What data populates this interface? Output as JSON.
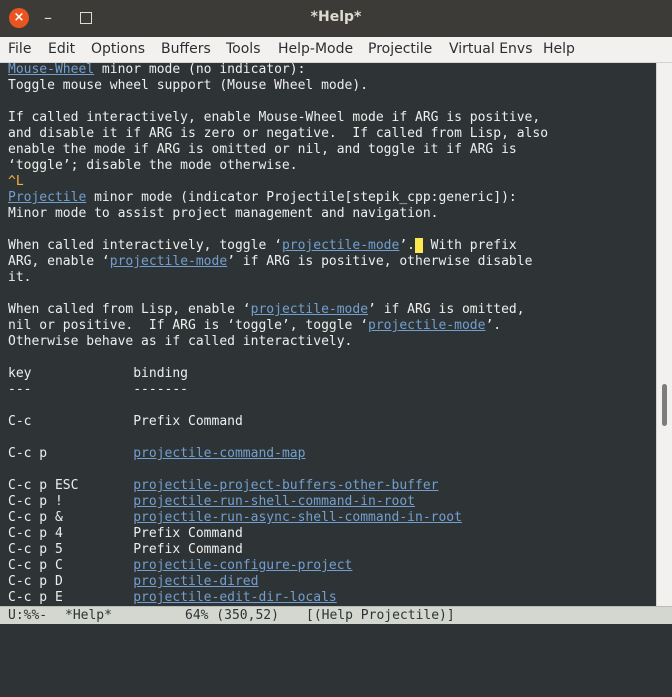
{
  "window": {
    "title": "*Help*",
    "close_glyph": "×",
    "minimize_glyph": "–"
  },
  "menu": [
    "File",
    "Edit",
    "Options",
    "Buffers",
    "Tools",
    "Help-Mode",
    "Projectile",
    "Virtual Envs",
    "Help"
  ],
  "buffer_lines": [
    [
      {
        "t": "Mouse-Wheel",
        "link": true
      },
      {
        "t": " minor mode (no indicator):"
      }
    ],
    [
      {
        "t": "Toggle mouse wheel support (Mouse Wheel mode)."
      }
    ],
    [],
    [
      {
        "t": "If called interactively, enable Mouse-Wheel mode if ARG is positive,"
      }
    ],
    [
      {
        "t": "and disable it if ARG is zero or negative.  If called from Lisp, also"
      }
    ],
    [
      {
        "t": "enable the mode if ARG is omitted or nil, and toggle it if ARG is"
      }
    ],
    [
      {
        "t": "‘toggle’; disable the mode otherwise."
      }
    ],
    [
      {
        "t": "^L",
        "ctl": true
      }
    ],
    [
      {
        "t": "Projectile",
        "link": true
      },
      {
        "t": " minor mode (indicator Projectile[stepik_cpp:generic]):"
      }
    ],
    [
      {
        "t": "Minor mode to assist project management and navigation."
      }
    ],
    [],
    [
      {
        "t": "When called interactively, toggle ‘"
      },
      {
        "t": "projectile-mode",
        "link": true
      },
      {
        "t": "’."
      },
      {
        "t": " ",
        "cursor": true
      },
      {
        "t": " With prefix"
      }
    ],
    [
      {
        "t": "ARG, enable ‘"
      },
      {
        "t": "projectile-mode",
        "link": true
      },
      {
        "t": "’ if ARG is positive, otherwise disable"
      }
    ],
    [
      {
        "t": "it."
      }
    ],
    [],
    [
      {
        "t": "When called from Lisp, enable ‘"
      },
      {
        "t": "projectile-mode",
        "link": true
      },
      {
        "t": "’ if ARG is omitted,"
      }
    ],
    [
      {
        "t": "nil or positive.  If ARG is ‘toggle’, toggle ‘"
      },
      {
        "t": "projectile-mode",
        "link": true
      },
      {
        "t": "’."
      }
    ],
    [
      {
        "t": "Otherwise behave as if called interactively."
      }
    ],
    [],
    [
      {
        "t": "key             binding"
      }
    ],
    [
      {
        "t": "---             -------"
      }
    ],
    [],
    [
      {
        "t": "C-c             Prefix Command"
      }
    ],
    [],
    [
      {
        "t": "C-c p           "
      },
      {
        "t": "projectile-command-map",
        "link": true
      }
    ],
    [],
    [
      {
        "t": "C-c p ESC       "
      },
      {
        "t": "projectile-project-buffers-other-buffer",
        "link": true
      }
    ],
    [
      {
        "t": "C-c p !         "
      },
      {
        "t": "projectile-run-shell-command-in-root",
        "link": true
      }
    ],
    [
      {
        "t": "C-c p &         "
      },
      {
        "t": "projectile-run-async-shell-command-in-root",
        "link": true
      }
    ],
    [
      {
        "t": "C-c p 4         Prefix Command"
      }
    ],
    [
      {
        "t": "C-c p 5         Prefix Command"
      }
    ],
    [
      {
        "t": "C-c p C         "
      },
      {
        "t": "projectile-configure-project",
        "link": true
      }
    ],
    [
      {
        "t": "C-c p D         "
      },
      {
        "t": "projectile-dired",
        "link": true
      }
    ],
    [
      {
        "t": "C-c p E         "
      },
      {
        "t": "projectile-edit-dir-locals",
        "link": true
      }
    ]
  ],
  "modeline": {
    "status": "U:%%-",
    "buffer": "*Help*",
    "position": "64% (350,52)",
    "modes": "[(Help Projectile)]"
  },
  "colors": {
    "background": "#2e3436",
    "foreground": "#eeeeec",
    "link": "#729fcf",
    "control_char": "#fcaf3e",
    "cursor": "#fce94f",
    "close_button": "#e95420"
  },
  "scroll_position_fraction": 0.64
}
